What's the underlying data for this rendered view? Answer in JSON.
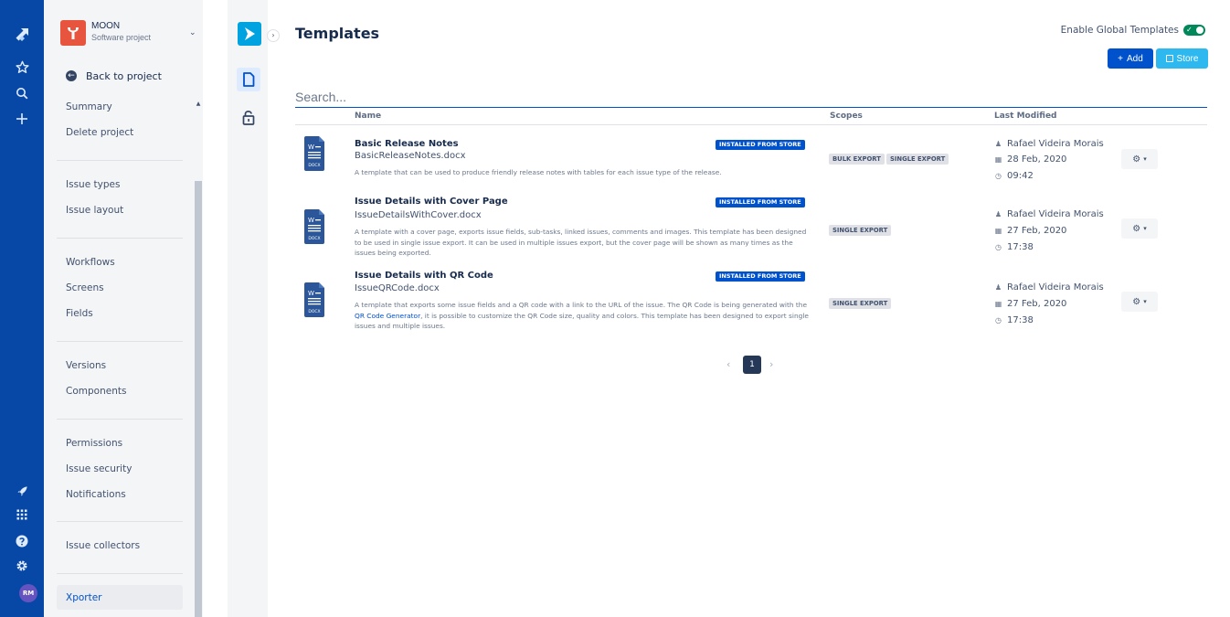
{
  "global_nav": {
    "top_icons": [
      "jira-logo-icon",
      "star-icon",
      "search-icon",
      "plus-icon"
    ],
    "bottom_icons": [
      "rocket-icon",
      "apps-grid-icon",
      "help-icon",
      "settings-icon"
    ],
    "avatar_initials": "RM"
  },
  "project": {
    "name": "MOON",
    "type": "Software project",
    "back_label": "Back to project"
  },
  "sidebar": {
    "items": [
      "Summary",
      "Delete project",
      "Issue types",
      "Issue layout",
      "Workflows",
      "Screens",
      "Fields",
      "Versions",
      "Components",
      "Permissions",
      "Issue security",
      "Notifications",
      "Issue collectors"
    ],
    "active_item": "Xporter"
  },
  "main": {
    "title": "Templates",
    "global_toggle_label": "Enable Global Templates",
    "global_toggle_on": true,
    "add_label": "Add",
    "store_label": "Store",
    "search_placeholder": "Search...",
    "columns": [
      "Name",
      "Scopes",
      "Last Modified"
    ],
    "rows": [
      {
        "name": "Basic Release Notes",
        "file": "BasicReleaseNotes.docx",
        "desc": "A template that can be used to produce friendly release notes with tables for each issue type of the release.",
        "badge": "INSTALLED FROM STORE",
        "scopes": [
          "BULK EXPORT",
          "SINGLE EXPORT"
        ],
        "author": "Rafael Videira Morais",
        "date": "28 Feb, 2020",
        "time": "09:42"
      },
      {
        "name": "Issue Details with Cover Page",
        "file": "IssueDetailsWithCover.docx",
        "desc": "A template with a cover page, exports issue fields, sub-tasks, linked issues, comments and images. This template has been designed to be used in single issue export. It can be used in multiple issues export, but the cover page will be shown as many times as the issues being exported.",
        "badge": "INSTALLED FROM STORE",
        "scopes": [
          "SINGLE EXPORT"
        ],
        "author": "Rafael Videira Morais",
        "date": "27 Feb, 2020",
        "time": "17:38"
      },
      {
        "name": "Issue Details with QR Code",
        "file": "IssueQRCode.docx",
        "desc_before": "A template that exports some issue fields and a QR code with a link to the URL of the issue. The QR Code is being generated with the ",
        "desc_link": "QR Code Generator",
        "desc_after": ", it is possible to customize the QR Code size, quality and colors. This template has been designed to export single issues and multiple issues.",
        "badge": "INSTALLED FROM STORE",
        "scopes": [
          "SINGLE EXPORT"
        ],
        "author": "Rafael Videira Morais",
        "date": "27 Feb, 2020",
        "time": "17:38"
      }
    ],
    "doc_icon_label": "DOCX",
    "pagination": {
      "current": "1"
    }
  },
  "colors": {
    "global_nav": "#0747a6",
    "primary": "#0052cc",
    "store": "#2eb8f0",
    "toggle_on": "#00875a",
    "app_logo": "#00a3e0",
    "project_logo": "#e8553e"
  }
}
